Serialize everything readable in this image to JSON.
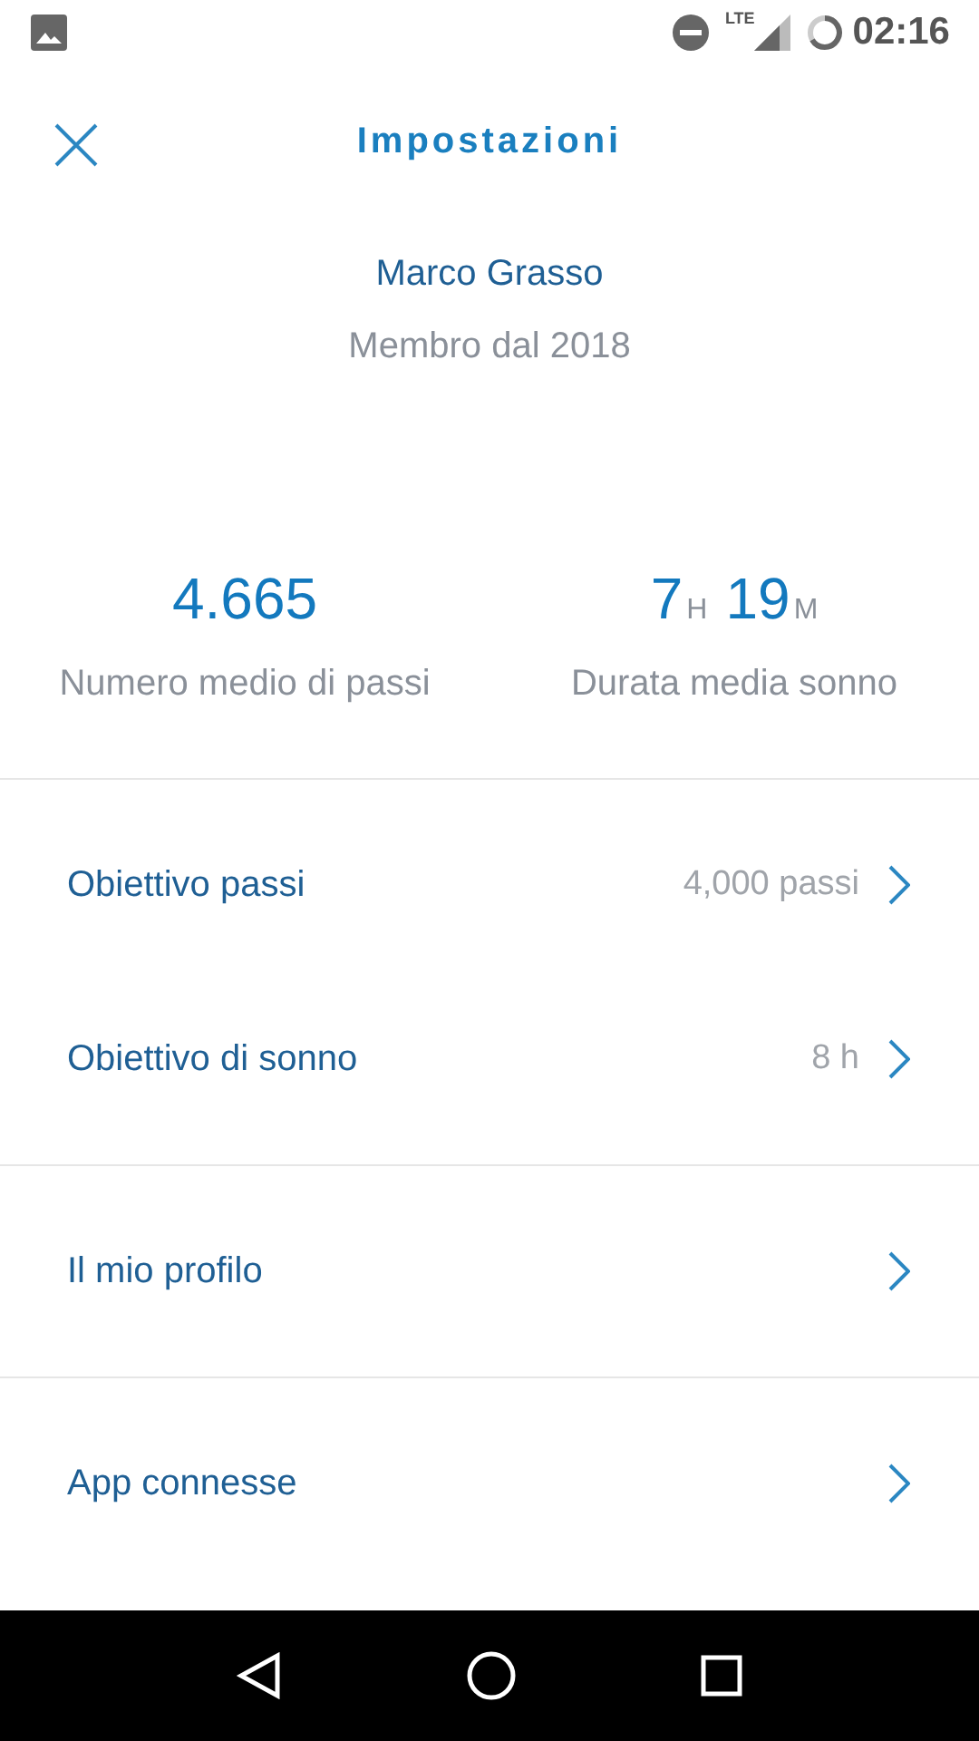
{
  "status_bar": {
    "time": "02:16",
    "network": "LTE"
  },
  "header": {
    "title": "Impostazioni"
  },
  "profile": {
    "name": "Marco Grasso",
    "member_since": "Membro dal 2018"
  },
  "stats": [
    {
      "parts": [
        {
          "kind": "number",
          "text": "4.665"
        }
      ],
      "label": "Numero medio di passi"
    },
    {
      "parts": [
        {
          "kind": "number",
          "text": "7"
        },
        {
          "kind": "unit",
          "text": "H"
        },
        {
          "kind": "number",
          "text": "19"
        },
        {
          "kind": "unit",
          "text": "M"
        }
      ],
      "label": "Durata media sonno"
    }
  ],
  "sections": [
    [
      {
        "label": "Obiettivo passi",
        "value": "4,000 passi"
      },
      {
        "label": "Obiettivo di sonno",
        "value": "8 h"
      }
    ],
    [
      {
        "label": "Il mio profilo"
      }
    ],
    [
      {
        "label": "App connesse"
      }
    ]
  ]
}
